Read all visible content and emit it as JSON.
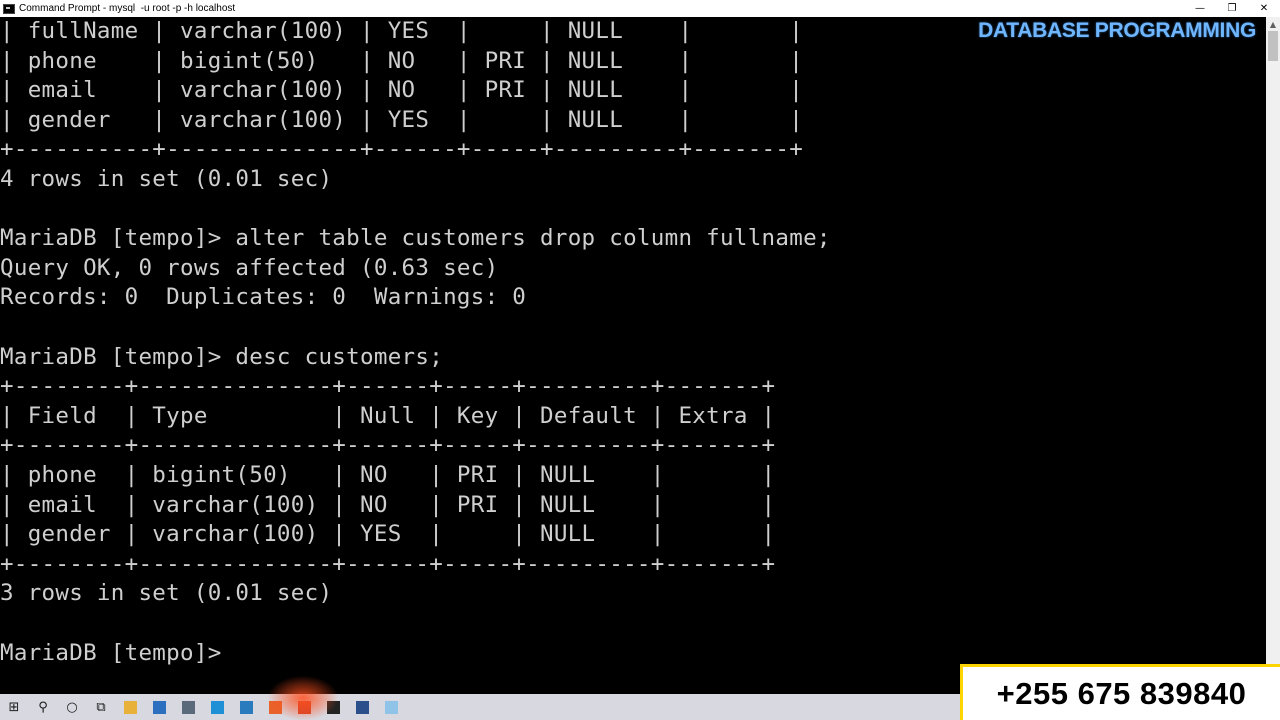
{
  "window": {
    "title": "Command Prompt - mysql  -u root -p -h localhost",
    "controls": [
      "—",
      "❐",
      "✕"
    ]
  },
  "overlay": {
    "channel_label": "DATABASE PROGRAMMING",
    "phone": "+255 675 839840"
  },
  "console": {
    "lines": [
      "| fullName | varchar(100) | YES  |     | NULL    |       |",
      "| phone    | bigint(50)   | NO   | PRI | NULL    |       |",
      "| email    | varchar(100) | NO   | PRI | NULL    |       |",
      "| gender   | varchar(100) | YES  |     | NULL    |       |",
      "+----------+--------------+------+-----+---------+-------+",
      "4 rows in set (0.01 sec)",
      "",
      "MariaDB [tempo]> alter table customers drop column fullname;",
      "Query OK, 0 rows affected (0.63 sec)",
      "Records: 0  Duplicates: 0  Warnings: 0",
      "",
      "MariaDB [tempo]> desc customers;",
      "+--------+--------------+------+-----+---------+-------+",
      "| Field  | Type         | Null | Key | Default | Extra |",
      "+--------+--------------+------+-----+---------+-------+",
      "| phone  | bigint(50)   | NO   | PRI | NULL    |       |",
      "| email  | varchar(100) | NO   | PRI | NULL    |       |",
      "| gender | varchar(100) | YES  |     | NULL    |       |",
      "+--------+--------------+------+-----+---------+-------+",
      "3 rows in set (0.01 sec)",
      "",
      "MariaDB [tempo]>"
    ]
  },
  "taskbar": {
    "icons": [
      {
        "name": "windows-start-icon",
        "glyph": "⊞",
        "color": "#1a1a1a"
      },
      {
        "name": "search-icon",
        "glyph": "⚲",
        "color": "#1a1a1a"
      },
      {
        "name": "cortana-icon",
        "glyph": "○",
        "color": "#1a1a1a"
      },
      {
        "name": "task-view-icon",
        "glyph": "⧉",
        "color": "#1a1a1a"
      },
      {
        "name": "file-explorer-icon",
        "glyph": "",
        "color": "#e8b23a"
      },
      {
        "name": "mail-icon",
        "glyph": "",
        "color": "#2c6fbf"
      },
      {
        "name": "network-icon",
        "glyph": "",
        "color": "#5a6a7a"
      },
      {
        "name": "edge-icon",
        "glyph": "",
        "color": "#1f8fd6"
      },
      {
        "name": "calculator-icon",
        "glyph": "",
        "color": "#2a7bbd"
      },
      {
        "name": "firefox-icon",
        "glyph": "",
        "color": "#e8622a"
      },
      {
        "name": "powerpoint-icon",
        "glyph": "",
        "color": "#d2452a"
      },
      {
        "name": "command-prompt-icon",
        "glyph": "",
        "color": "#222222"
      },
      {
        "name": "save-icon",
        "glyph": "",
        "color": "#2b4f8a"
      },
      {
        "name": "notepad-icon",
        "glyph": "",
        "color": "#8fc4e8"
      }
    ]
  }
}
